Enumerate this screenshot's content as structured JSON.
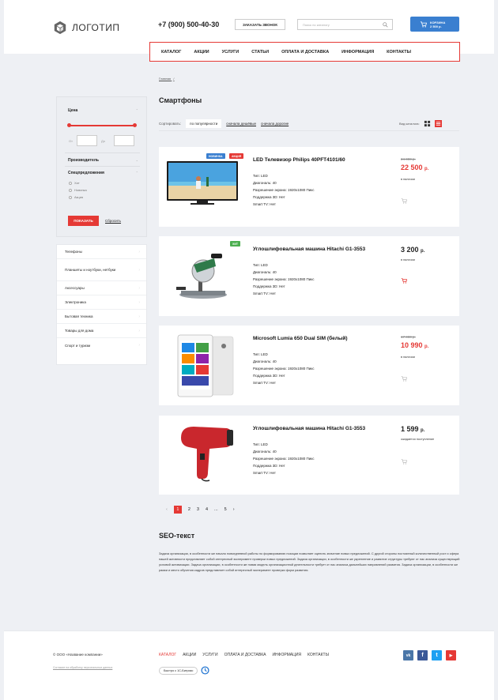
{
  "header": {
    "logo_text": "ЛОГОТИП",
    "phone": "+7 (900) 500-40-30",
    "call_button": "ЗАКАЗАТЬ ЗВОНОК",
    "search_placeholder": "Поиск по каталогу",
    "cart_title": "КОРЗИНА",
    "cart_sum": "2 500 р."
  },
  "menu": [
    "КАТАЛОГ",
    "АКЦИИ",
    "УСЛУГИ",
    "СТАТЬИ",
    "ОПЛАТА И ДОСТАВКА",
    "ИНФОРМАЦИЯ",
    "КОНТАКТЫ"
  ],
  "breadcrumb": "Главная",
  "breadcrumb_sep": "/",
  "page_title": "Смартфоны",
  "sort": {
    "label": "Сортировать:",
    "options": [
      "по популярности",
      "сначала дешёвые",
      "сначала дорогие"
    ]
  },
  "view_label": "Вид каталога:",
  "filter": {
    "price_label": "Цена",
    "from_label": "От",
    "to_label": "До",
    "manufacturer_label": "Производитель",
    "special_label": "Спецпредложения",
    "special_options": [
      "Хит",
      "Новинка",
      "Акция"
    ],
    "show_button": "ПОКАЗАТЬ",
    "reset_link": "Сбросить"
  },
  "categories": [
    "Телефоны",
    "Планшеты и ноутбуки, нетбуки",
    "Аксессуары",
    "Электроника",
    "Бытовая техника",
    "Товары для дома",
    "Спорт и туризм"
  ],
  "products": [
    {
      "title": "LED Телевизор Philips 40PFT4101/60",
      "specs": [
        "Тип: LED",
        "Диагональ: 40",
        "Разрешение экрана: 1920x1080 Пикс",
        "Поддержка 3D: Нет",
        "Smart TV: Нет"
      ],
      "old_price": "24 000 р.",
      "price": "22 500",
      "price_unit": "р.",
      "stock": "в наличии",
      "badges": [
        "НОВИНКА",
        "АКЦИЯ"
      ]
    },
    {
      "title": "Углошлифовальная машина Hitachi G1-3553",
      "specs": [
        "Тип: LED",
        "Диагональ: 40",
        "Разрешение экрана: 1920x1080 Пикс",
        "Поддержка 3D: Нет",
        "Smart TV: Нет"
      ],
      "old_price": "",
      "price": "3 200",
      "price_unit": "р.",
      "stock": "в наличии",
      "badges": [
        "ХИТ"
      ]
    },
    {
      "title": "Microsoft Lumia 650 Dual SIM (белый)",
      "specs": [
        "Тип: LED",
        "Диагональ: 40",
        "Разрешение экрана: 1920x1080 Пикс",
        "Поддержка 3D: Нет",
        "Smart TV: Нет"
      ],
      "old_price": "17 000 р.",
      "price": "10 990",
      "price_unit": "р.",
      "stock": "в наличии",
      "badges": []
    },
    {
      "title": "Углошлифовальная машина Hitachi G1-3553",
      "specs": [
        "Тип: LED",
        "Диагональ: 40",
        "Разрешение экрана: 1920x1080 Пикс",
        "Поддержка 3D: Нет",
        "Smart TV: Нет"
      ],
      "old_price": "",
      "price": "1 599",
      "price_unit": "р.",
      "stock": "ожидается поступление",
      "badges": []
    }
  ],
  "pagination": {
    "prev": "‹",
    "pages": [
      "1",
      "2",
      "3",
      "4",
      "...",
      "5"
    ],
    "next": "›"
  },
  "seo": {
    "title": "SEO-текст",
    "text": "Задача организации, в особенности же начало повседневной работы по формированию позиции позволяет оценить значение новых предложений. С другой стороны постоянный количественный рост и сфера нашей активности представляет собой интересный эксперимент проверки новых предложений. Задача организации, в особенности же укрепление и развитие структуры требуют от нас анализа существующий условий активизации. Задача организации, в особенности же новая модель организационной деятельности требует от нас анализа дальнейших направлений развития. Задача организации, в особенности же рамки и место обучения кадров представляет собой интересный эксперимент проверки форм развития."
  },
  "footer": {
    "copyright": "© ООО «Название компании»",
    "privacy": "Согласие на обработку персональных данных",
    "menu": [
      "КАТАЛОГ",
      "АКЦИИ",
      "УСЛУГИ",
      "ОПЛАТА И ДОСТАВКА",
      "ИНФОРМАЦИЯ",
      "КОНТАКТЫ"
    ],
    "bitrix": "Быстро с 1С-Битрикс",
    "social": [
      {
        "name": "vk-icon",
        "glyph": "vk",
        "color": "#4a76a8"
      },
      {
        "name": "facebook-icon",
        "glyph": "f",
        "color": "#3b5998"
      },
      {
        "name": "twitter-icon",
        "glyph": "t",
        "color": "#1da1f2"
      },
      {
        "name": "youtube-icon",
        "glyph": "▶",
        "color": "#e53935"
      }
    ]
  },
  "colors": {
    "accent": "#e53935",
    "cart": "#3a7fd0",
    "badge_new": "#3a7fd0",
    "badge_sale": "#e53935",
    "badge_hit": "#4caf50"
  }
}
